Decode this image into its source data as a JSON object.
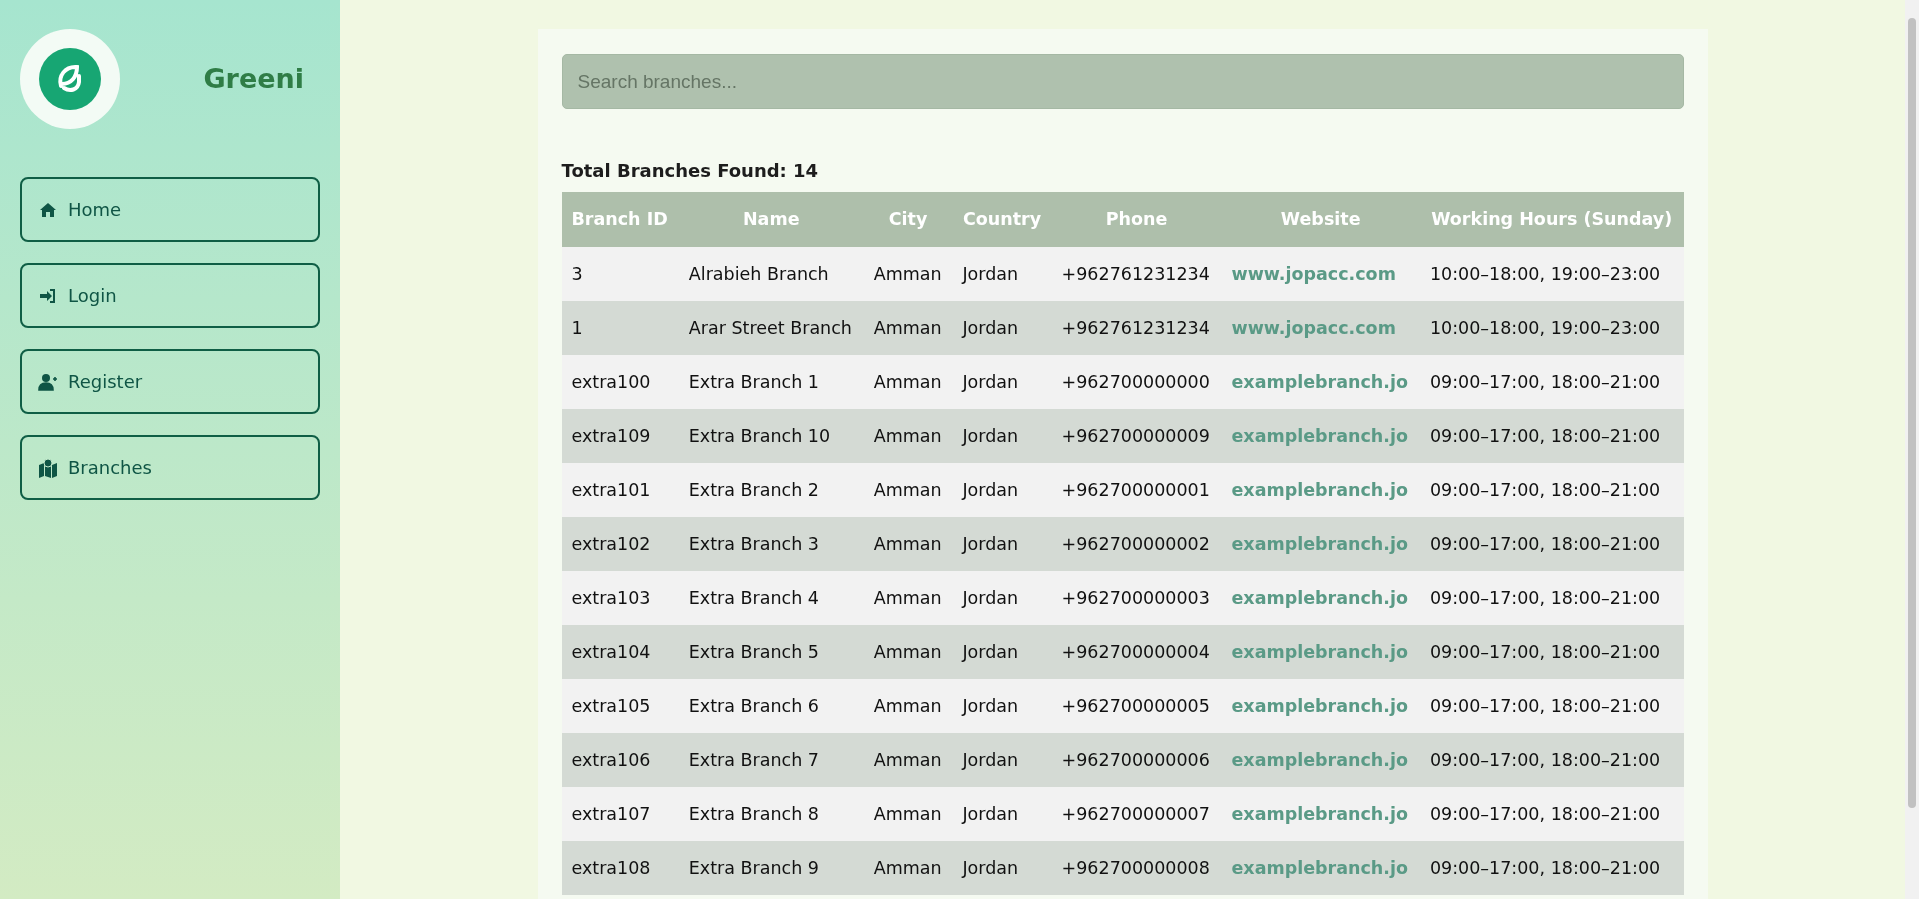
{
  "sidebar": {
    "brand": "Greeni",
    "items": [
      {
        "label": "Home"
      },
      {
        "label": "Login"
      },
      {
        "label": "Register"
      },
      {
        "label": "Branches"
      }
    ]
  },
  "search": {
    "placeholder": "Search branches..."
  },
  "total": "Total Branches Found: 14",
  "table": {
    "columns": [
      "Branch ID",
      "Name",
      "City",
      "Country",
      "Phone",
      "Website",
      "Working Hours (Sunday)"
    ],
    "rows": [
      [
        "3",
        "Alrabieh Branch",
        "Amman",
        "Jordan",
        "+962761231234",
        "www.jopacc.com",
        "10:00–18:00, 19:00–23:00"
      ],
      [
        "1",
        "Arar Street Branch",
        "Amman",
        "Jordan",
        "+962761231234",
        "www.jopacc.com",
        "10:00–18:00, 19:00–23:00"
      ],
      [
        "extra100",
        "Extra Branch 1",
        "Amman",
        "Jordan",
        "+962700000000",
        "examplebranch.jo",
        "09:00–17:00, 18:00–21:00"
      ],
      [
        "extra109",
        "Extra Branch 10",
        "Amman",
        "Jordan",
        "+962700000009",
        "examplebranch.jo",
        "09:00–17:00, 18:00–21:00"
      ],
      [
        "extra101",
        "Extra Branch 2",
        "Amman",
        "Jordan",
        "+962700000001",
        "examplebranch.jo",
        "09:00–17:00, 18:00–21:00"
      ],
      [
        "extra102",
        "Extra Branch 3",
        "Amman",
        "Jordan",
        "+962700000002",
        "examplebranch.jo",
        "09:00–17:00, 18:00–21:00"
      ],
      [
        "extra103",
        "Extra Branch 4",
        "Amman",
        "Jordan",
        "+962700000003",
        "examplebranch.jo",
        "09:00–17:00, 18:00–21:00"
      ],
      [
        "extra104",
        "Extra Branch 5",
        "Amman",
        "Jordan",
        "+962700000004",
        "examplebranch.jo",
        "09:00–17:00, 18:00–21:00"
      ],
      [
        "extra105",
        "Extra Branch 6",
        "Amman",
        "Jordan",
        "+962700000005",
        "examplebranch.jo",
        "09:00–17:00, 18:00–21:00"
      ],
      [
        "extra106",
        "Extra Branch 7",
        "Amman",
        "Jordan",
        "+962700000006",
        "examplebranch.jo",
        "09:00–17:00, 18:00–21:00"
      ],
      [
        "extra107",
        "Extra Branch 8",
        "Amman",
        "Jordan",
        "+962700000007",
        "examplebranch.jo",
        "09:00–17:00, 18:00–21:00"
      ],
      [
        "extra108",
        "Extra Branch 9",
        "Amman",
        "Jordan",
        "+962700000008",
        "examplebranch.jo",
        "09:00–17:00, 18:00–21:00"
      ]
    ]
  }
}
